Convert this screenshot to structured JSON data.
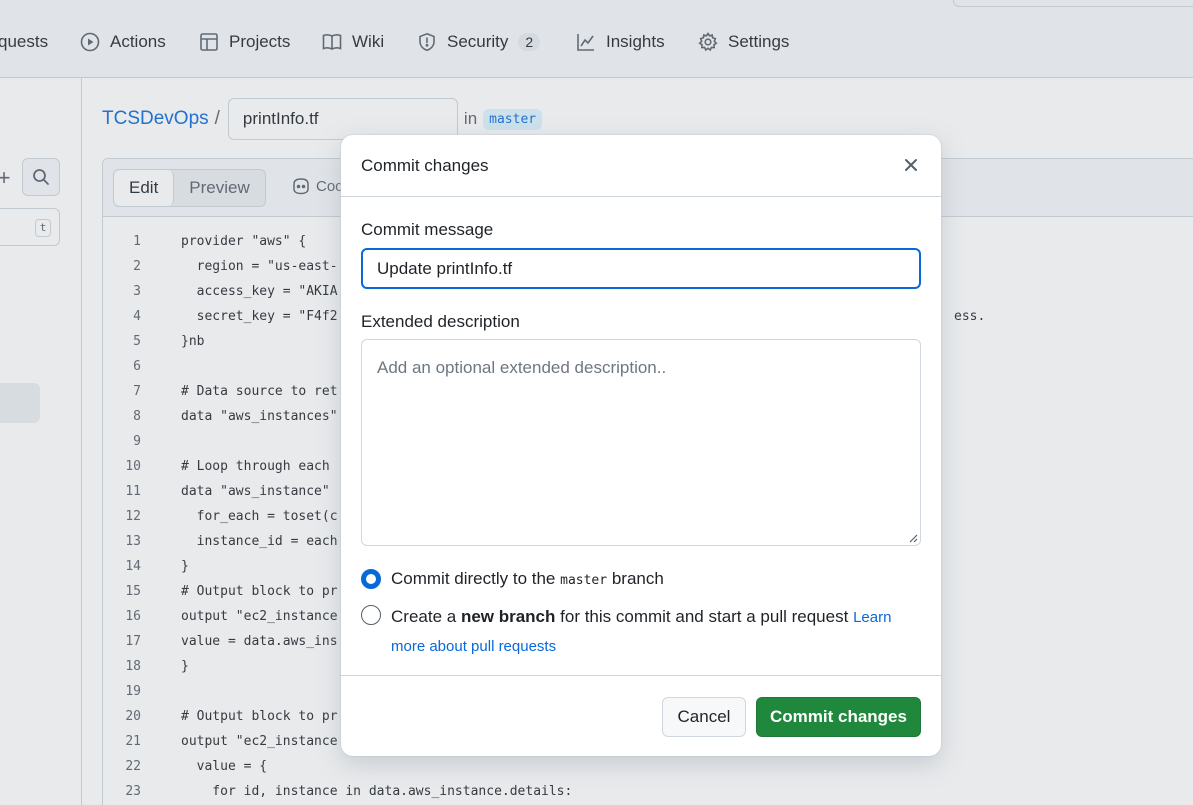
{
  "repo_nav": {
    "items": [
      {
        "label": "quests",
        "icon": "pull-request-icon"
      },
      {
        "label": "Actions",
        "icon": "play-circle-icon"
      },
      {
        "label": "Projects",
        "icon": "table-icon"
      },
      {
        "label": "Wiki",
        "icon": "book-icon"
      },
      {
        "label": "Security",
        "icon": "shield-icon",
        "count": "2"
      },
      {
        "label": "Insights",
        "icon": "graph-icon"
      },
      {
        "label": "Settings",
        "icon": "gear-icon"
      }
    ]
  },
  "sidebar": {
    "filter_shortcut": "t"
  },
  "breadcrumb": {
    "owner": "TCSDevOps",
    "separator": "/",
    "filename": "printInfo.tf",
    "in_label": "in",
    "branch": "master"
  },
  "editor": {
    "tabs": [
      "Edit",
      "Preview"
    ],
    "copilot_label": "Coc",
    "lines": [
      {
        "n": "1",
        "t": "provider \"aws\" {"
      },
      {
        "n": "2",
        "t": "  region = \"us-east-"
      },
      {
        "n": "3",
        "t": "  access_key = \"AKIA"
      },
      {
        "n": "4",
        "t": "  secret_key = \"F4f2"
      },
      {
        "n": "5",
        "t": "}nb"
      },
      {
        "n": "6",
        "t": ""
      },
      {
        "n": "7",
        "t": "# Data source to ret"
      },
      {
        "n": "8",
        "t": "data \"aws_instances\""
      },
      {
        "n": "9",
        "t": ""
      },
      {
        "n": "10",
        "t": "# Loop through each"
      },
      {
        "n": "11",
        "t": "data \"aws_instance\""
      },
      {
        "n": "12",
        "t": "  for_each = toset(c"
      },
      {
        "n": "13",
        "t": "  instance_id = each"
      },
      {
        "n": "14",
        "t": "}"
      },
      {
        "n": "15",
        "t": "# Output block to pr"
      },
      {
        "n": "16",
        "t": "output \"ec2_instance"
      },
      {
        "n": "17",
        "t": "value = data.aws_ins"
      },
      {
        "n": "18",
        "t": "}"
      },
      {
        "n": "19",
        "t": ""
      },
      {
        "n": "20",
        "t": "# Output block to pr"
      },
      {
        "n": "21",
        "t": "output \"ec2_instance"
      },
      {
        "n": "22",
        "t": "  value = {"
      },
      {
        "n": "23",
        "t": "    for id, instance in data.aws_instance.details:"
      }
    ],
    "line4_tail": "ess."
  },
  "dialog": {
    "title": "Commit changes",
    "message_label": "Commit message",
    "message_value": "Update printInfo.tf",
    "description_label": "Extended description",
    "description_placeholder": "Add an optional extended description..",
    "option_direct": {
      "prefix": "Commit directly to the",
      "branch": "master",
      "suffix": "branch",
      "checked": true
    },
    "option_new": {
      "prefix": "Create a",
      "bold": "new branch",
      "suffix": "for this commit and start a pull request",
      "link": "Learn more about pull requests",
      "checked": false
    },
    "cancel_label": "Cancel",
    "commit_label": "Commit changes"
  },
  "colors": {
    "accent": "#0969da",
    "primary_button": "#1f883d",
    "border": "#d0d7de"
  }
}
